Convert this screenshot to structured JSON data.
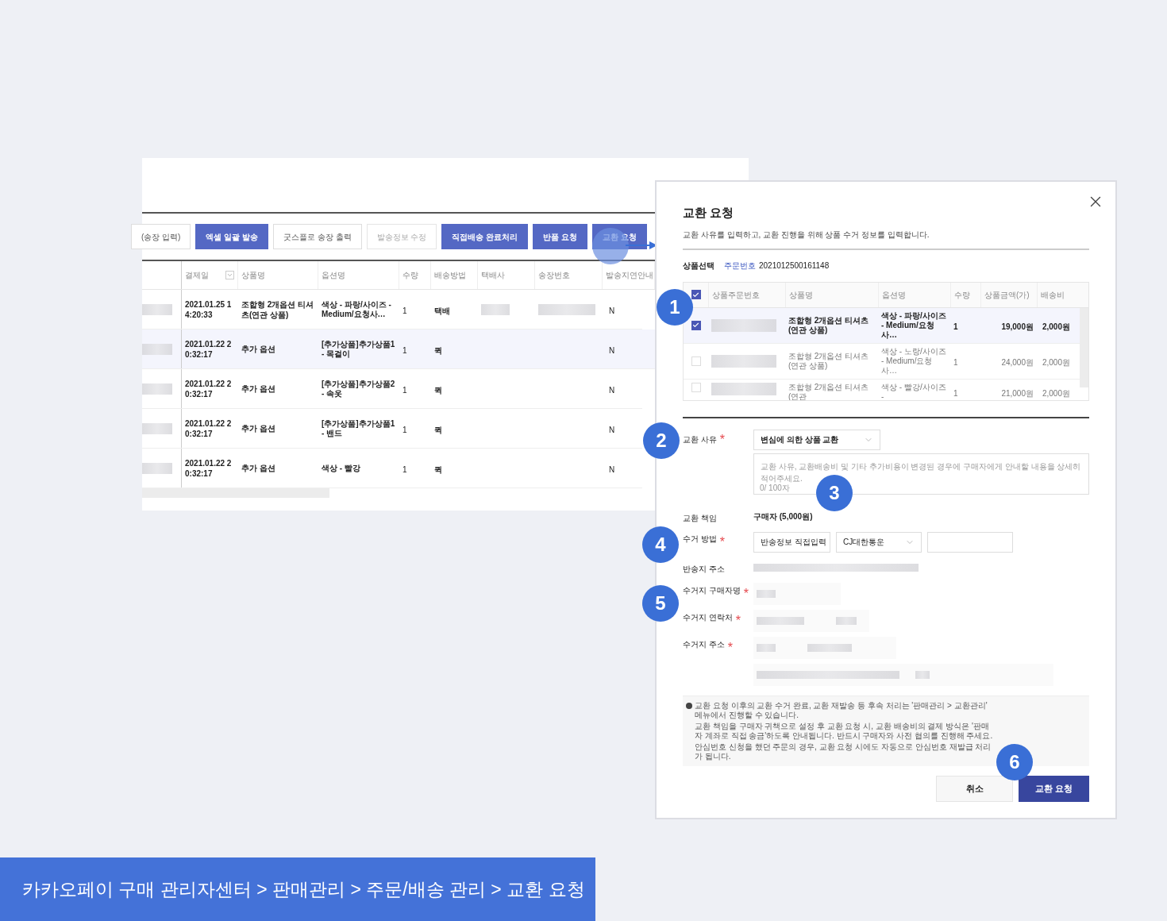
{
  "toolbar": {
    "buttons": [
      {
        "label": "(송장 입력)",
        "kind": "outline"
      },
      {
        "label": "엑셀 일괄 발송",
        "kind": "primary"
      },
      {
        "label": "굿스플로 송장 출력",
        "kind": "outline"
      },
      {
        "label": "발송정보 수정",
        "kind": "disabled"
      },
      {
        "label": "직접배송 완료처리",
        "kind": "primary"
      },
      {
        "label": "반품 요청",
        "kind": "primary"
      },
      {
        "label": "교환 요청",
        "kind": "primary"
      }
    ]
  },
  "orders_table": {
    "columns": [
      "결제일",
      "상품명",
      "옵션명",
      "수량",
      "배송방법",
      "택배사",
      "송장번호",
      "발송지연안내"
    ],
    "rows": [
      {
        "selected": false,
        "carrier_shown": true,
        "date": "2021.01.25 14:20:33",
        "product": "조합형 2개옵션 티셔츠(연관 상품)",
        "option": "색상 - 파랑/사이즈 - Medium/요청사…",
        "quantity": "1",
        "method": "택배",
        "delay": "N"
      },
      {
        "selected": true,
        "carrier_shown": false,
        "date": "2021.01.22 20:32:17",
        "product": "추가 옵션",
        "option": "[추가상품]추가상품1 - 목걸이",
        "quantity": "1",
        "method": "퀵",
        "delay": "N"
      },
      {
        "selected": false,
        "carrier_shown": false,
        "date": "2021.01.22 20:32:17",
        "product": "추가 옵션",
        "option": "[추가상품]추가상품2 - 속옷",
        "quantity": "1",
        "method": "퀵",
        "delay": "N"
      },
      {
        "selected": false,
        "carrier_shown": false,
        "date": "2021.01.22 20:32:17",
        "product": "추가 옵션",
        "option": "[추가상품]추가상품1 - 밴드",
        "quantity": "1",
        "method": "퀵",
        "delay": "N"
      },
      {
        "selected": false,
        "carrier_shown": false,
        "date": "2021.01.22 20:32:17",
        "product": "추가 옵션",
        "option": "색상 - 빨강",
        "quantity": "1",
        "method": "퀵",
        "delay": "N"
      }
    ]
  },
  "modal": {
    "title": "교환 요청",
    "subtitle": "교환 사유를 입력하고, 교환 진행을 위해 상품 수거 정보를 입력합니다.",
    "product_select": {
      "label": "상품선택",
      "order_label": "주문번호",
      "order_number": "2021012500161148"
    },
    "table": {
      "all_checked": true,
      "columns": [
        "상품주문번호",
        "상품명",
        "옵션명",
        "수량",
        "상품금액(가)",
        "배송비"
      ],
      "rows": [
        {
          "checked": true,
          "selected": true,
          "product": "조합형 2개옵션 티셔츠(연관 상품)",
          "option": "색상 - 파랑/사이즈 - Medium/요청사…",
          "quantity": "1",
          "price": "19,000원",
          "shipping": "2,000원"
        },
        {
          "checked": false,
          "selected": false,
          "product": "조합형 2개옵션 티셔츠(연관 상품)",
          "option": "색상 - 노랑/사이즈 - Medium/요청사…",
          "quantity": "1",
          "price": "24,000원",
          "shipping": "2,000원"
        },
        {
          "checked": false,
          "selected": false,
          "product": "조합형 2개옵션 티셔츠(연관",
          "option": "색상 - 빨강/사이즈 -",
          "quantity": "1",
          "price": "21,000원",
          "shipping": "2,000원"
        }
      ]
    },
    "reason": {
      "label": "교환 사유",
      "required_mark": "*",
      "value": "변심에 의한 상품 교환",
      "placeholder": "교환 사유, 교환배송비 및 기타 추가비용이 변경된 경우에 구매자에게 안내할 내용을 상세히 적어주세요.",
      "counter": "0/ 100자"
    },
    "responsibility": {
      "label": "교환 책임",
      "value": "구매자 (5,000원)"
    },
    "pickup_method": {
      "label": "수거 방법",
      "required_mark": "*",
      "method": "반송정보 직접입력",
      "courier": "CJ대한통운"
    },
    "return_address": {
      "label": "반송지 주소"
    },
    "pickup_fields": [
      {
        "label": "수거지 구매자명",
        "required_mark": "*"
      },
      {
        "label": "수거지 연락처",
        "required_mark": "*"
      },
      {
        "label": "수거지 주소",
        "required_mark": "*"
      }
    ],
    "notes": [
      "교환 요청 이후의 교환 수거 완료, 교환 재발송 등 후속 처리는 '판매관리 > 교환관리' 메뉴에서 진행할 수 있습니다.",
      "교환 책임을 구매자 귀책으로 설정 후 교환 요청 시, 교환 배송비의 결제 방식은 '판매자 계좌로 직접 송금'하도록 안내됩니다. 반드시 구매자와 사전 협의를 진행해 주세요.",
      "안심번호 신청을 했던 주문의 경우, 교환 요청 시에도 자동으로 안심번호 재발급 처리가 됩니다."
    ],
    "buttons": {
      "cancel": "취소",
      "submit": "교환 요청"
    }
  },
  "callouts": [
    "1",
    "2",
    "3",
    "4",
    "5",
    "6"
  ],
  "banner": {
    "breadcrumb": "카카오페이 구매 관리자센터 > 판매관리 > 주문/배송 관리 > 교환 요청"
  }
}
